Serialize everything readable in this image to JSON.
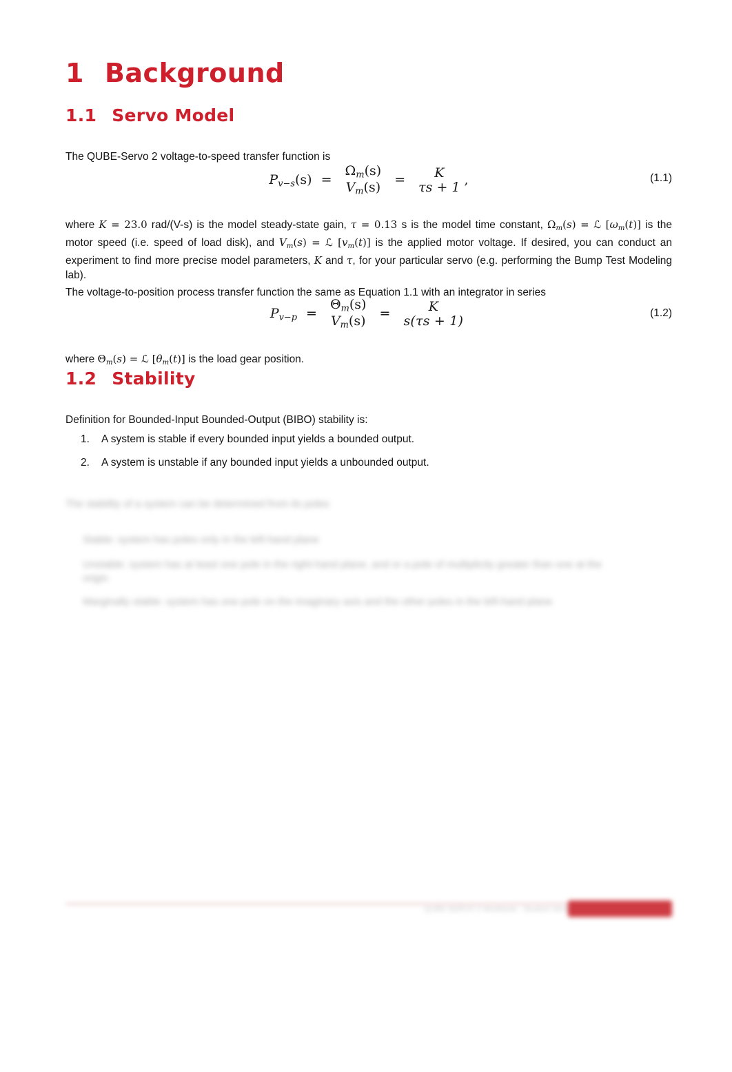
{
  "document": {
    "section": {
      "number": "1",
      "title": "Background"
    },
    "subsections": [
      {
        "number": "1.1",
        "title": "Servo Model"
      },
      {
        "number": "1.2",
        "title": "Stability"
      }
    ]
  },
  "servo_model": {
    "intro_paragraph": "The QUBE-Servo 2 voltage-to-speed transfer function is",
    "equation_1_1": {
      "number": "(1.1)",
      "lhs": "P",
      "lhs_sub": "v−s",
      "lhs_arg": "(s)",
      "frac1_num_sym": "Ω",
      "frac1_num_sub": "m",
      "frac1_num_arg": "(s)",
      "frac1_den_sym": "V",
      "frac1_den_sub": "m",
      "frac1_den_arg": "(s)",
      "frac2_num": "K",
      "frac2_den": "τs + 1",
      "trailing": ","
    },
    "parameters_paragraph": {
      "part1": "where ",
      "math1": "K = 23.0",
      "part2": " rad/(V-s) is the model steady-state gain, ",
      "math2": "τ = 0.13",
      "part3": " s is the model time constant, ",
      "math3": "Ωm(s) = ℒ [ωm(t)]",
      "part4": " is the motor speed (i.e. speed of load disk), and ",
      "math4": "Vm(s) = ℒ [vm(t)]",
      "part5": " is the applied motor voltage. If desired, you can conduct an experiment to find more precise model parameters, ",
      "math5": "K",
      "part6": " and ",
      "math6": "τ",
      "part7": ", for your particular servo (e.g. performing the Bump Test Modeling lab).",
      "gain_value": "23.0",
      "gain_symbol": "K",
      "gain_units": "rad/(V-s)",
      "time_constant_value": "0.13",
      "time_constant_symbol": "τ",
      "time_constant_units": "s"
    },
    "position_paragraph": "The voltage-to-position process transfer function the same as Equation 1.1 with an integrator in series",
    "equation_1_2": {
      "number": "(1.2)",
      "lhs": "P",
      "lhs_sub": "v−p",
      "frac1_num_sym": "Θ",
      "frac1_num_sub": "m",
      "frac1_num_arg": "(s)",
      "frac1_den_sym": "V",
      "frac1_den_sub": "m",
      "frac1_den_arg": "(s)",
      "frac2_num": "K",
      "frac2_den": "s(τs + 1)"
    },
    "position_note": {
      "prefix": "where ",
      "math": "Θm(s) = ℒ [θm(t)]",
      "suffix": " is the load gear position."
    }
  },
  "stability": {
    "definition_intro": "Definition for Bounded-Input Bounded-Output (BIBO) stability is:",
    "items": [
      {
        "marker": "1.",
        "text": "A system is stable if every bounded input yields a bounded output."
      },
      {
        "marker": "2.",
        "text": "A system is unstable if any bounded input yields a unbounded output."
      }
    ],
    "redacted": {
      "note": "illegible-blurred-content",
      "paragraph": "The stability of a system can be determined from its poles",
      "items": [
        "Stable: system has poles only in the left-hand plane",
        "Unstable: system has at least one pole in the right-hand plane, and or a pole of multiplicity greater than one at the origin",
        "Marginally stable: system has one pole on the imaginary axis and the other poles in the left-hand plane"
      ]
    }
  },
  "footer": {
    "text": "QUBE-SERVO 2 Workbook - Student Version",
    "brand_block": "brand-bar"
  },
  "colors": {
    "heading_red": "#CE202C",
    "body_text": "#151515",
    "footer_brand": "#CE3B42",
    "footer_rule": "#E7BCBE",
    "page_background": "#FFFFFF"
  }
}
